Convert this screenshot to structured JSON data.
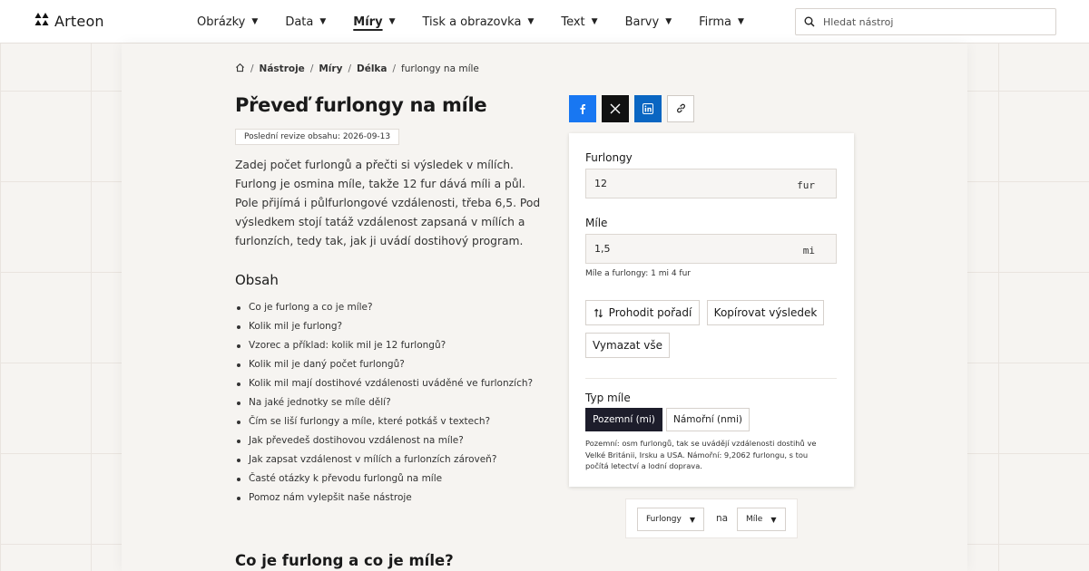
{
  "brand": {
    "name": "Arteon"
  },
  "nav": [
    {
      "label": "Obrázky",
      "active": false
    },
    {
      "label": "Data",
      "active": false
    },
    {
      "label": "Míry",
      "active": true
    },
    {
      "label": "Tisk a obrazovka",
      "active": false
    },
    {
      "label": "Text",
      "active": false
    },
    {
      "label": "Barvy",
      "active": false
    },
    {
      "label": "Firma",
      "active": false
    }
  ],
  "search": {
    "placeholder": "Hledat nástroj",
    "value": ""
  },
  "breadcrumb": {
    "home_icon": "home-icon",
    "items": [
      "Nástroje",
      "Míry",
      "Délka"
    ],
    "current": "furlongy na míle"
  },
  "page": {
    "title": "Převeď furlongy na míle",
    "revision": "Poslední revize obsahu: 2026-09-13",
    "intro": "Zadej počet furlongů a přečti si výsledek v mílích. Furlong je osmina míle, takže 12 fur dává míli a půl. Pole přijímá i půlfurlongové vzdálenosti, třeba 6,5. Pod výsledkem stojí tatáž vzdálenost zapsaná v mílích a furlonzích, tedy tak, jak ji uvádí dostihový program.",
    "toc_title": "Obsah",
    "toc": [
      "Co je furlong a co je míle?",
      "Kolik mil je furlong?",
      "Vzorec a příklad: kolik mil je 12 furlongů?",
      "Kolik mil je daný počet furlongů?",
      "Kolik mil mají dostihové vzdálenosti uváděné ve furlonzích?",
      "Na jaké jednotky se míle dělí?",
      "Čím se liší furlongy a míle, které potkáš v textech?",
      "Jak převedeš dostihovou vzdálenost na míle?",
      "Jak zapsat vzdálenost v mílích a furlonzích zároveň?",
      "Časté otázky k převodu furlongů na míle",
      "Pomoz nám vylepšit naše nástroje"
    ],
    "section_heading": "Co je furlong a co je míle?"
  },
  "share": {
    "icons": [
      "facebook-icon",
      "x-icon",
      "linkedin-icon",
      "link-icon"
    ]
  },
  "converter": {
    "from_label": "Furlongy",
    "from_value": "12",
    "from_unit": "fur",
    "to_label": "Míle",
    "to_value": "1,5",
    "to_unit": "mi",
    "hint": "Míle a furlongy: 1 mi 4 fur",
    "swap_label": "Prohodit pořadí",
    "copy_label": "Kopírovat výsledek",
    "clear_label": "Vymazat vše",
    "type_label": "Typ míle",
    "type_options": [
      "Pozemní (mi)",
      "Námořní (nmi)"
    ],
    "type_note": "Pozemní: osm furlongů, tak se uvádějí vzdálenosti dostihů ve Velké Británii, Irsku a USA. Námořní: 9,2062 furlongu, s tou počítá letectví a lodní doprava."
  },
  "unit_picker": {
    "from": "Furlongy",
    "connector": "na",
    "to": "Míle"
  },
  "colors": {
    "accent": "#1d1d2b",
    "facebook": "#1877f2",
    "linkedin": "#0a66c2",
    "x": "#111111"
  }
}
